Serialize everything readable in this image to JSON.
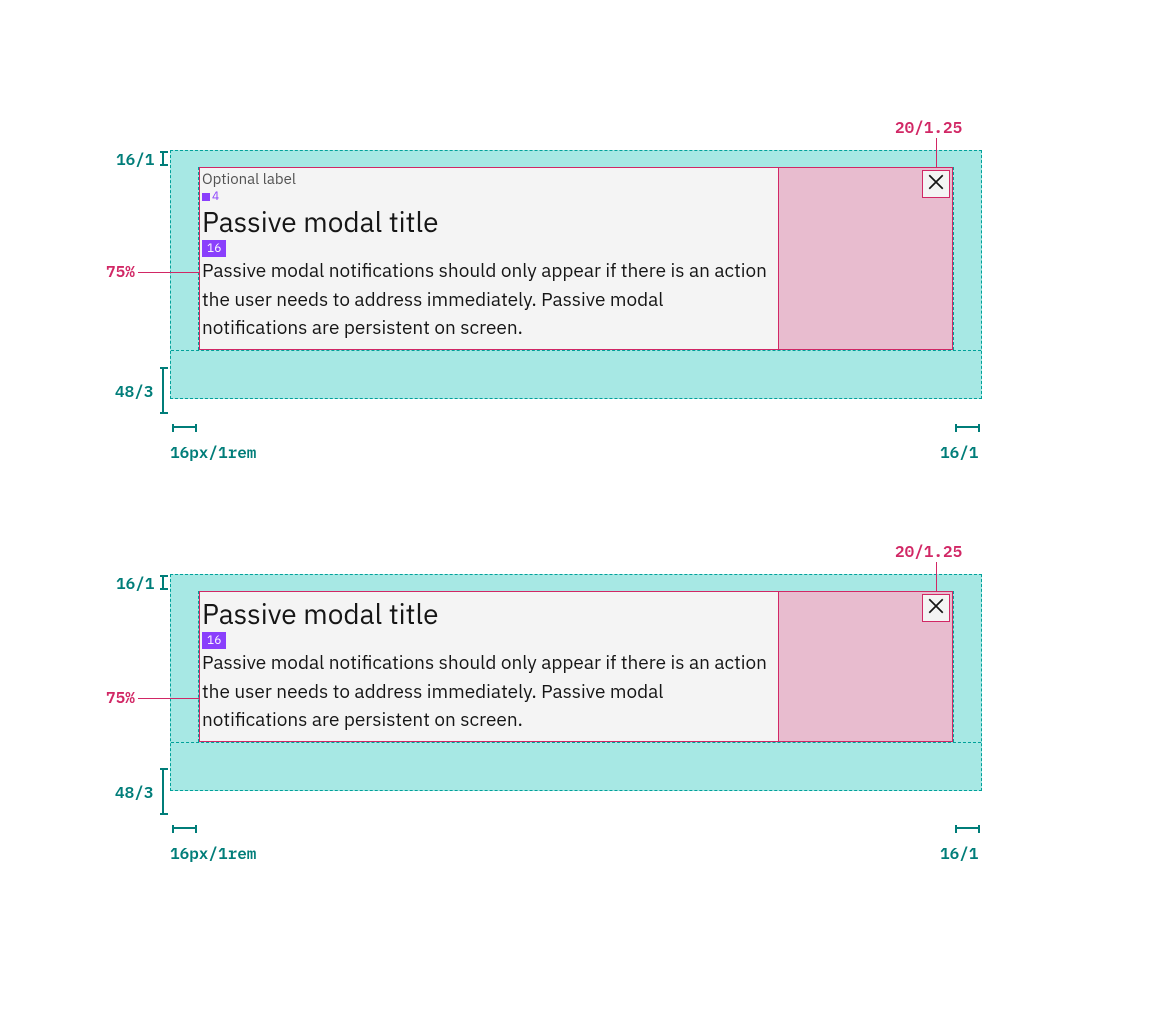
{
  "annotations": {
    "top_padding": "16/1",
    "bottom_padding": "48/3",
    "left_padding": "16px/1rem",
    "right_padding": "16/1",
    "content_width": "75%",
    "close_size": "20/1.25",
    "gap_label": "4",
    "title_gap": "16"
  },
  "modal1": {
    "label": "Optional label",
    "title": "Passive modal title",
    "body": "Passive modal notifications should only appear if there is an action the user needs to address immediately. Passive modal notifications are persistent on screen."
  },
  "modal2": {
    "title": "Passive modal title",
    "body": "Passive modal notifications should only appear if there is an action the user needs to address immediately. Passive modal notifications are persistent on screen."
  }
}
